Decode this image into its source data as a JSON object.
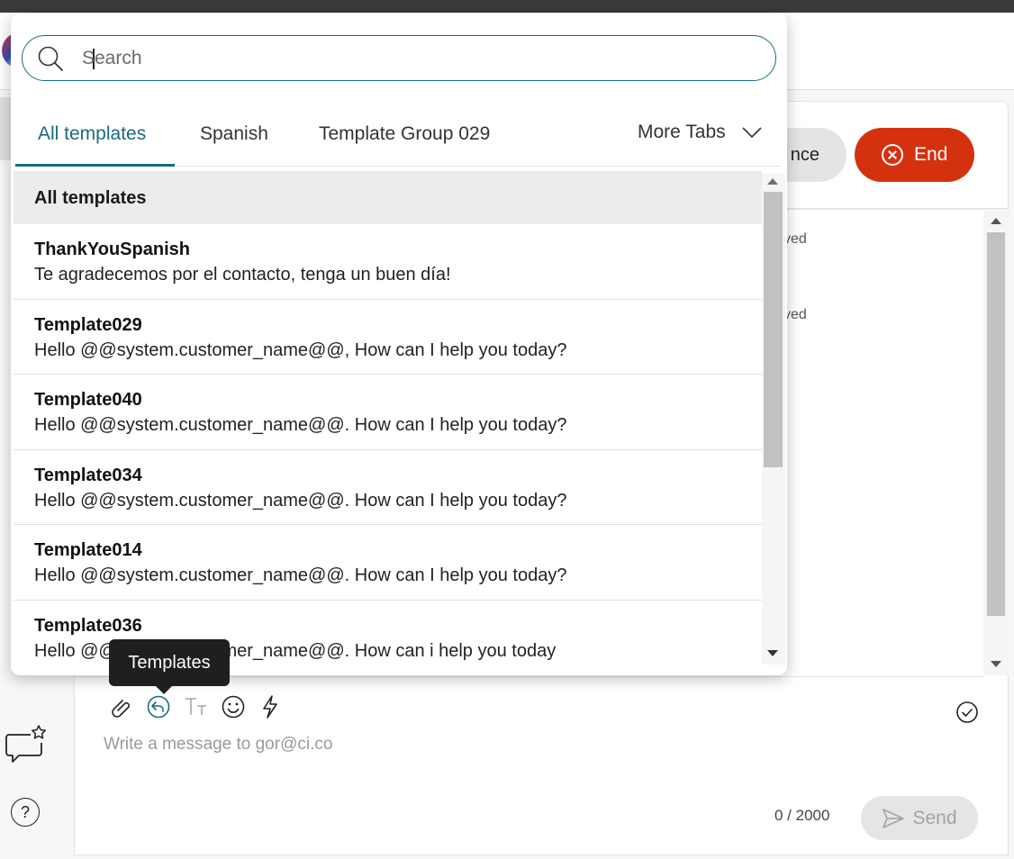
{
  "popover": {
    "search": {
      "placeholder": "Search",
      "value": ""
    },
    "tabs": [
      {
        "label": "All templates",
        "active": true
      },
      {
        "label": "Spanish",
        "active": false
      },
      {
        "label": "Template Group 029",
        "active": false
      }
    ],
    "more_tabs_label": "More Tabs",
    "list_header": "All templates",
    "items": [
      {
        "name": "ThankYouSpanish",
        "text": "Te agradecemos por el contacto, tenga un buen día!"
      },
      {
        "name": "Template029",
        "text": "Hello @@system.customer_name@@, How can I help you today?"
      },
      {
        "name": "Template040",
        "text": "Hello @@system.customer_name@@. How can I help you today?"
      },
      {
        "name": "Template034",
        "text": "Hello @@system.customer_name@@. How can I help you today?"
      },
      {
        "name": "Template014",
        "text": "Hello @@system.customer_name@@. How can I help you today?"
      },
      {
        "name": "Template036",
        "text": "Hello @@system.customer_name@@. How can i help you today"
      }
    ]
  },
  "tooltip": "Templates",
  "header": {
    "conference_label": "nce",
    "end_label": "End"
  },
  "background": {
    "status_1": "ved",
    "status_2": "ved"
  },
  "composer": {
    "placeholder": "Write a message to gor@ci.co",
    "char_count": "0 / 2000",
    "send_label": "Send"
  },
  "colors": {
    "accent": "#1a6b80",
    "end_button": "#d4310f",
    "tooltip_bg": "#1f1f1f"
  }
}
